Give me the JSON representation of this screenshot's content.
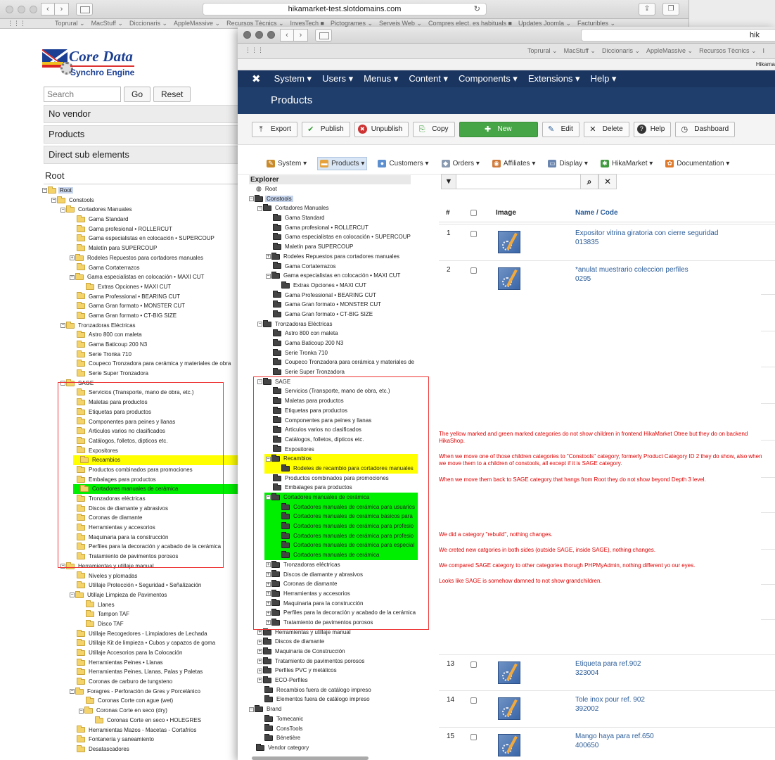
{
  "back_window": {
    "url": "hikamarket-test.slotdomains.com",
    "bookmarks": [
      "Toprural ⌄",
      "MacStuff ⌄",
      "Diccionaris ⌄",
      "AppleMassive ⌄",
      "Recursos Tècnics ⌄",
      "InvesTech ■",
      "Pictogrames ⌄",
      "Serveis Web ⌄",
      "Compres elect. es habituals ■",
      "Updates Joomla ⌄",
      "Facturibles ⌄"
    ],
    "logo": {
      "title": "Core Data",
      "subtitle": "Synchro Engine"
    },
    "search": {
      "placeholder": "Search",
      "go_label": "Go",
      "reset_label": "Reset"
    },
    "menu": {
      "no_vendor": "No vendor",
      "products": "Products",
      "direct_sub": "Direct sub elements"
    },
    "root_title": "Root",
    "tree": [
      {
        "d": 0,
        "t": "-",
        "label": "Root",
        "hl": "root"
      },
      {
        "d": 1,
        "t": "-",
        "label": "Constools"
      },
      {
        "d": 2,
        "t": "-",
        "label": "Cortadores Manuales"
      },
      {
        "d": 3,
        "t": "",
        "label": "Gama Standard"
      },
      {
        "d": 3,
        "t": "",
        "label": "Gama profesional • ROLLERCUT"
      },
      {
        "d": 3,
        "t": "",
        "label": "Gama especialistas en colocación • SUPERCOUP"
      },
      {
        "d": 3,
        "t": "",
        "label": "Maletín para SUPERCOUP"
      },
      {
        "d": 3,
        "t": "+",
        "label": "Rodeles Repuestos para cortadores manuales"
      },
      {
        "d": 3,
        "t": "",
        "label": "Gama Cortaterrazos"
      },
      {
        "d": 3,
        "t": "-",
        "label": "Gama especialistas en colocación • MAXI CUT"
      },
      {
        "d": 4,
        "t": "",
        "label": "Extras Opciones • MAXI CUT"
      },
      {
        "d": 3,
        "t": "",
        "label": "Gama Professional • BEARING CUT"
      },
      {
        "d": 3,
        "t": "",
        "label": "Gama Gran formato • MONSTER CUT"
      },
      {
        "d": 3,
        "t": "",
        "label": "Gama Gran formato • CT-BIG SIZE"
      },
      {
        "d": 2,
        "t": "-",
        "label": "Tronzadoras Eléctricas"
      },
      {
        "d": 3,
        "t": "",
        "label": "Astro 800 con maleta"
      },
      {
        "d": 3,
        "t": "",
        "label": "Gama Baticoup 200 N3"
      },
      {
        "d": 3,
        "t": "",
        "label": "Serie Tronka 710"
      },
      {
        "d": 3,
        "t": "",
        "label": "Coupeco Tronzadora para cerámica y materiales de obra"
      },
      {
        "d": 3,
        "t": "",
        "label": "Serie Super Tronzadora"
      },
      {
        "d": 2,
        "t": "-",
        "label": "SAGE"
      },
      {
        "d": 3,
        "t": "",
        "label": "Servicios (Transporte, mano de obra, etc.)"
      },
      {
        "d": 3,
        "t": "",
        "label": "Maletas para productos"
      },
      {
        "d": 3,
        "t": "",
        "label": "Etiquetas para productos"
      },
      {
        "d": 3,
        "t": "",
        "label": "Componentes para peines y llanas"
      },
      {
        "d": 3,
        "t": "",
        "label": "Articulos varios no clasificados"
      },
      {
        "d": 3,
        "t": "",
        "label": "Catálogos, folletos, dipticos etc."
      },
      {
        "d": 3,
        "t": "",
        "label": "Expositores"
      },
      {
        "d": 3,
        "t": "",
        "label": "Recambios",
        "hl": "yellow"
      },
      {
        "d": 3,
        "t": "",
        "label": "Productos combinados para promociones"
      },
      {
        "d": 3,
        "t": "",
        "label": "Embalages para productos"
      },
      {
        "d": 3,
        "t": "",
        "label": "Cortadores manuales de cerámica",
        "hl": "green"
      },
      {
        "d": 3,
        "t": "",
        "label": "Tronzadoras eléctricas"
      },
      {
        "d": 3,
        "t": "",
        "label": "Discos de diamante y abrasivos"
      },
      {
        "d": 3,
        "t": "",
        "label": "Coronas de diamante"
      },
      {
        "d": 3,
        "t": "",
        "label": "Herramientas y accesorios"
      },
      {
        "d": 3,
        "t": "",
        "label": "Maquinaria para la construcción"
      },
      {
        "d": 3,
        "t": "",
        "label": "Perfiles para la decoración y acabado de la cerámica"
      },
      {
        "d": 3,
        "t": "",
        "label": "Tratamiento de pavimentos porosos"
      },
      {
        "d": 2,
        "t": "-",
        "label": "Herramientas y utillaje manual"
      },
      {
        "d": 3,
        "t": "",
        "label": "Niveles y plomadas"
      },
      {
        "d": 3,
        "t": "",
        "label": "Utillaje Protección • Seguridad • Señalización"
      },
      {
        "d": 3,
        "t": "-",
        "label": "Utillaje Limpieza de Pavimentos"
      },
      {
        "d": 4,
        "t": "",
        "label": "Llanes"
      },
      {
        "d": 4,
        "t": "",
        "label": "Tampon TAF"
      },
      {
        "d": 4,
        "t": "",
        "label": "Disco TAF"
      },
      {
        "d": 3,
        "t": "",
        "label": "Utillaje Recogedores - Limpiadores de Lechada"
      },
      {
        "d": 3,
        "t": "",
        "label": "Utillaje Kit de limpieza • Cubos y capazos de goma"
      },
      {
        "d": 3,
        "t": "",
        "label": "Utillaje Accesorios para la Colocación"
      },
      {
        "d": 3,
        "t": "",
        "label": "Herramientas Peines • Llanas"
      },
      {
        "d": 3,
        "t": "",
        "label": "Herramientas Peines, Llanas, Palas y Paletas"
      },
      {
        "d": 3,
        "t": "",
        "label": "Coronas de carburo de tungsteno"
      },
      {
        "d": 3,
        "t": "-",
        "label": "Foragres - Perforación de Gres y Porcelánico"
      },
      {
        "d": 4,
        "t": "",
        "label": "Coronas Corte con ague (wet)"
      },
      {
        "d": 4,
        "t": "-",
        "label": "Coronas Corte en seco (dry)"
      },
      {
        "d": 5,
        "t": "",
        "label": "Coronas Corte en seco • HOLEGRES"
      },
      {
        "d": 3,
        "t": "",
        "label": "Herramientas Mazos - Macetas - Cortafríos"
      },
      {
        "d": 3,
        "t": "",
        "label": "Fontanería y saneamiento"
      },
      {
        "d": 3,
        "t": "",
        "label": "Desatascadores"
      }
    ]
  },
  "front_window": {
    "url_fragment": "hik",
    "bookmarks": [
      "Toprural ⌄",
      "MacStuff ⌄",
      "Diccionaris ⌄",
      "AppleMassive ⌄",
      "Recursos Tècnics ⌄",
      "I"
    ],
    "hikama_fragment": "Hikama",
    "admin_menu": [
      "System ▾",
      "Users ▾",
      "Menus ▾",
      "Content ▾",
      "Components ▾",
      "Extensions ▾",
      "Help ▾"
    ],
    "page_title": "Products",
    "toolbar": [
      {
        "icon": "⤒",
        "label": "Export"
      },
      {
        "icon": "✔",
        "label": "Publish"
      },
      {
        "icon": "✖",
        "label": "Unpublish"
      },
      {
        "icon": "⎘",
        "label": "Copy"
      },
      {
        "icon": "✚",
        "label": "New",
        "variant": "new"
      },
      {
        "icon": "✎",
        "label": "Edit"
      },
      {
        "icon": "✕",
        "label": "Delete"
      },
      {
        "icon": "?",
        "label": "Help"
      },
      {
        "icon": "◷",
        "label": "Dashboard"
      }
    ],
    "hika_menu": [
      {
        "label": "System ▾",
        "icon": "✎",
        "color": "#c98a2a"
      },
      {
        "label": "Products ▾",
        "icon": "▬",
        "color": "#e6a23c",
        "active": true
      },
      {
        "label": "Customers ▾",
        "icon": "●",
        "color": "#5b8fd0"
      },
      {
        "label": "Orders ▾",
        "icon": "◆",
        "color": "#8a9ab0"
      },
      {
        "label": "Affiliates ▾",
        "icon": "◉",
        "color": "#d07a3a"
      },
      {
        "label": "Display ▾",
        "icon": "▭",
        "color": "#6a86b0"
      },
      {
        "label": "HikaMarket ▾",
        "icon": "✱",
        "color": "#3d9a3d"
      },
      {
        "label": "Documentation ▾",
        "icon": "✿",
        "color": "#e07a2a"
      }
    ],
    "explorer_title": "Explorer",
    "explorer_tree": [
      {
        "d": 0,
        "t": "",
        "label": "Root",
        "f": "globe"
      },
      {
        "d": 0,
        "t": "-",
        "label": "Constools",
        "hl": "root"
      },
      {
        "d": 1,
        "t": "-",
        "label": "Cortadores Manuales"
      },
      {
        "d": 2,
        "t": "",
        "label": "Gama Standard"
      },
      {
        "d": 2,
        "t": "",
        "label": "Gama profesional • ROLLERCUT"
      },
      {
        "d": 2,
        "t": "",
        "label": "Gama especialistas en colocación • SUPERCOUP"
      },
      {
        "d": 2,
        "t": "",
        "label": "Maletín para SUPERCOUP"
      },
      {
        "d": 2,
        "t": "+",
        "label": "Rodeles Repuestos para cortadores manuales"
      },
      {
        "d": 2,
        "t": "",
        "label": "Gama Cortaterrazos"
      },
      {
        "d": 2,
        "t": "-",
        "label": "Gama especialistas en colocación • MAXI CUT"
      },
      {
        "d": 3,
        "t": "",
        "label": "Extras Opciones • MAXI CUT"
      },
      {
        "d": 2,
        "t": "",
        "label": "Gama Professional • BEARING CUT"
      },
      {
        "d": 2,
        "t": "",
        "label": "Gama Gran formato • MONSTER CUT"
      },
      {
        "d": 2,
        "t": "",
        "label": "Gama Gran formato • CT-BIG SIZE"
      },
      {
        "d": 1,
        "t": "-",
        "label": "Tronzadoras Eléctricas"
      },
      {
        "d": 2,
        "t": "",
        "label": "Astro 800 con maleta"
      },
      {
        "d": 2,
        "t": "",
        "label": "Gama Baticoup 200 N3"
      },
      {
        "d": 2,
        "t": "",
        "label": "Serie Tronka 710"
      },
      {
        "d": 2,
        "t": "",
        "label": "Coupeco Tronzadora para cerámica y materiales de"
      },
      {
        "d": 2,
        "t": "",
        "label": "Serie Super Tronzadora"
      },
      {
        "d": 1,
        "t": "-",
        "label": "SAGE"
      },
      {
        "d": 2,
        "t": "",
        "label": "Servicios (Transporte, mano de obra, etc.)"
      },
      {
        "d": 2,
        "t": "",
        "label": "Maletas para productos"
      },
      {
        "d": 2,
        "t": "",
        "label": "Etiquetas para productos"
      },
      {
        "d": 2,
        "t": "",
        "label": "Componentes para peines y llanas"
      },
      {
        "d": 2,
        "t": "",
        "label": "Articulos varios no clasificados"
      },
      {
        "d": 2,
        "t": "",
        "label": "Catálogos, folletos, dipticos etc."
      },
      {
        "d": 2,
        "t": "",
        "label": "Expositores"
      },
      {
        "d": 2,
        "t": "-",
        "label": "Recambios",
        "hl": "yellow"
      },
      {
        "d": 3,
        "t": "",
        "label": "Rodeles de recambio para cortadores manuales",
        "hl": "yellow"
      },
      {
        "d": 2,
        "t": "",
        "label": "Productos combinados para promociones"
      },
      {
        "d": 2,
        "t": "",
        "label": "Embalages para productos"
      },
      {
        "d": 2,
        "t": "-",
        "label": "Cortadores manuales de cerámica",
        "hl": "green"
      },
      {
        "d": 3,
        "t": "",
        "label": "Cortadores manuales de cerámica para usuarios",
        "hl": "green"
      },
      {
        "d": 3,
        "t": "",
        "label": "Cortadores manuales de cerámica básicos para",
        "hl": "green"
      },
      {
        "d": 3,
        "t": "",
        "label": "Cortadores manuales de cerámica para profesio",
        "hl": "green"
      },
      {
        "d": 3,
        "t": "",
        "label": "Cortadores manuales de cerámica para profesio",
        "hl": "green"
      },
      {
        "d": 3,
        "t": "",
        "label": "Cortadores manuales de cerámica para especial",
        "hl": "green"
      },
      {
        "d": 3,
        "t": "",
        "label": "Cortadores manuales de cerámica",
        "hl": "green"
      },
      {
        "d": 2,
        "t": "+",
        "label": "Tronzadoras eléctricas"
      },
      {
        "d": 2,
        "t": "+",
        "label": "Discos de diamante y abrasivos"
      },
      {
        "d": 2,
        "t": "+",
        "label": "Coronas de diamante"
      },
      {
        "d": 2,
        "t": "+",
        "label": "Herramientas y accesorios"
      },
      {
        "d": 2,
        "t": "+",
        "label": "Maquinaria para la construcción"
      },
      {
        "d": 2,
        "t": "+",
        "label": "Perfiles para la decoración y acabado de la cerámica"
      },
      {
        "d": 2,
        "t": "+",
        "label": "Tratamiento de pavimentos porosos"
      },
      {
        "d": 1,
        "t": "+",
        "label": "Herramientas y utillaje manual"
      },
      {
        "d": 1,
        "t": "+",
        "label": "Discos de diamante"
      },
      {
        "d": 1,
        "t": "+",
        "label": "Maquinaria de Construcción"
      },
      {
        "d": 1,
        "t": "+",
        "label": "Tratamiento de pavimentos porosos"
      },
      {
        "d": 1,
        "t": "+",
        "label": "Perfiles PVC y metálicos"
      },
      {
        "d": 1,
        "t": "+",
        "label": "ECO-Perfiles"
      },
      {
        "d": 1,
        "t": "",
        "label": "Recambios fuera de catálogo impreso"
      },
      {
        "d": 1,
        "t": "",
        "label": "Elementos fuera de catálogo impreso"
      },
      {
        "d": 0,
        "t": "-",
        "label": "Brand"
      },
      {
        "d": 1,
        "t": "",
        "label": "Tomecanic"
      },
      {
        "d": 1,
        "t": "",
        "label": "ConsTools"
      },
      {
        "d": 1,
        "t": "",
        "label": "Bénetière"
      },
      {
        "d": 0,
        "t": "",
        "label": "Vendor category"
      }
    ],
    "grid": {
      "col_num": "#",
      "col_image": "Image",
      "col_name": "Name / Code",
      "rows": [
        {
          "num": "1",
          "name": "Expositor vitrina giratoria con cierre seguridad",
          "code": "013835"
        },
        {
          "num": "2",
          "name": "*anulat muestrario coleccion perfiles",
          "code": "0295"
        },
        {
          "num": "13",
          "name": "Etiqueta para ref.902",
          "code": "323004"
        },
        {
          "num": "14",
          "name": "Tole inox pour ref. 902",
          "code": "392002"
        },
        {
          "num": "15",
          "name": "Mango haya para ref.650",
          "code": "400650"
        }
      ]
    },
    "notes": [
      "The yellow marked and green marked categories do not show children in frontend HikaMarket Otree but they do on backend HikaShop.",
      "When we move one of those children categories to \"Constools\" category, formerly Product Category ID 2 they do show, also when we move them to a children of constools, all except if it is SAGE category.",
      "When we move them back to SAGE category that hangs from Root they do not show beyond Depth 3 level.",
      "We did a category \"rebuild\", nothing changes.",
      "We creted new catgories in both sides (outside SAGE, inside SAGE), nothing changes.",
      "We compared SAGE category to other categories thorugh PHPMyAdmin, nothing different yo our eyes.",
      "Looks like SAGE is somehow damned to not show grandchildren."
    ]
  }
}
